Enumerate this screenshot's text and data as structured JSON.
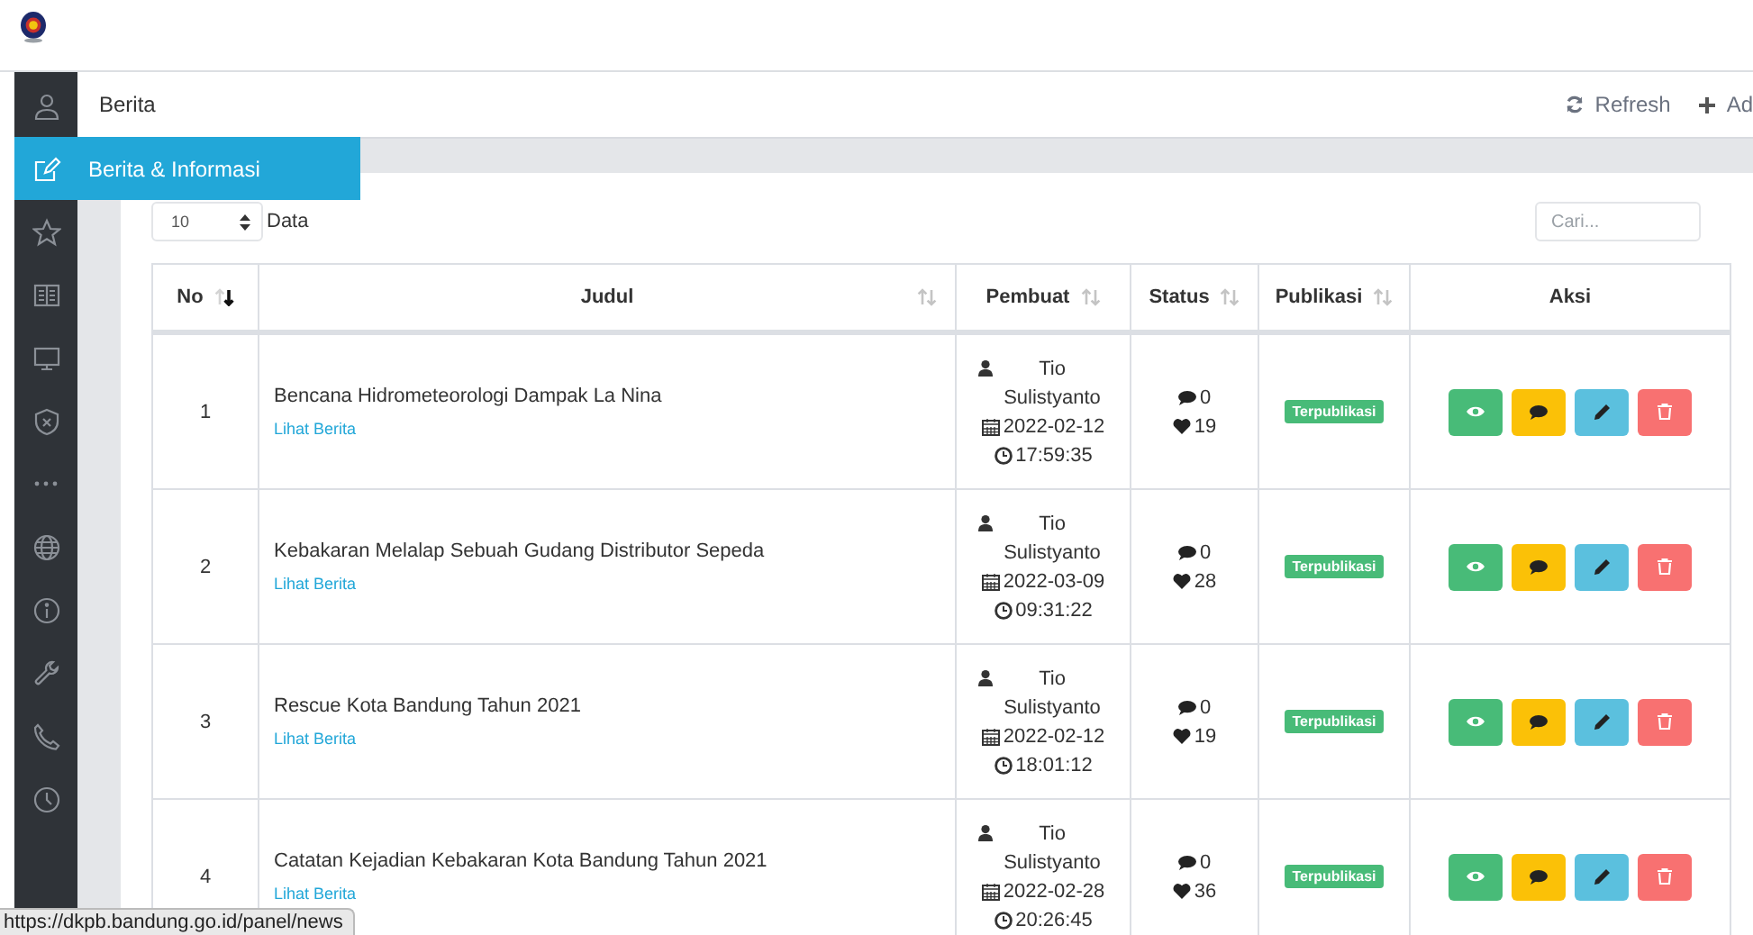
{
  "sidebar": {
    "items": [
      {
        "kind": "user",
        "selected": false
      },
      {
        "kind": "edit",
        "selected": true
      },
      {
        "kind": "star",
        "selected": false
      },
      {
        "kind": "book",
        "selected": false
      },
      {
        "kind": "monitor",
        "selected": false
      },
      {
        "kind": "shield",
        "selected": false
      },
      {
        "kind": "dots",
        "selected": false
      },
      {
        "kind": "globe",
        "selected": false
      },
      {
        "kind": "info",
        "selected": false
      },
      {
        "kind": "wrench",
        "selected": false
      },
      {
        "kind": "phone",
        "selected": false
      },
      {
        "kind": "clock",
        "selected": false
      }
    ],
    "flyout": "Berita & Informasi"
  },
  "toolbar": {
    "title": "Berita",
    "actions": [
      {
        "kind": "refresh",
        "label": "Refresh"
      },
      {
        "kind": "add",
        "label": "Ad"
      }
    ]
  },
  "page_size": {
    "value": "10",
    "label": "Data"
  },
  "search": {
    "placeholder": "Cari..."
  },
  "table": {
    "columns": [
      {
        "label": "No",
        "sortable": true,
        "sorted": true
      },
      {
        "label": "Judul",
        "sortable": true,
        "sorted": false
      },
      {
        "label": "Pembuat",
        "sortable": true,
        "sorted": false
      },
      {
        "label": "Status",
        "sortable": true,
        "sorted": false
      },
      {
        "label": "Publikasi",
        "sortable": true,
        "sorted": false
      },
      {
        "label": "Aksi",
        "sortable": false
      }
    ],
    "actions": [
      {
        "kind": "view"
      },
      {
        "kind": "comment"
      },
      {
        "kind": "edit"
      },
      {
        "kind": "delete"
      }
    ],
    "rows": [
      {
        "no": "1",
        "title": "Bencana Hidrometeorologi Dampak La Nina",
        "link": "Lihat Berita",
        "author": "Tio Sulistyanto",
        "date": "2022-02-12",
        "time": "17:59:35",
        "comments": "0",
        "likes": "19",
        "publication": "Terpublikasi"
      },
      {
        "no": "2",
        "title": "Kebakaran Melalap Sebuah Gudang Distributor Sepeda",
        "link": "Lihat Berita",
        "author": "Tio Sulistyanto",
        "date": "2022-03-09",
        "time": "09:31:22",
        "comments": "0",
        "likes": "28",
        "publication": "Terpublikasi"
      },
      {
        "no": "3",
        "title": "Rescue Kota Bandung Tahun 2021",
        "link": "Lihat Berita",
        "author": "Tio Sulistyanto",
        "date": "2022-02-12",
        "time": "18:01:12",
        "comments": "0",
        "likes": "19",
        "publication": "Terpublikasi"
      },
      {
        "no": "4",
        "title": "Catatan Kejadian Kebakaran Kota Bandung Tahun 2021",
        "link": "Lihat Berita",
        "author": "Tio Sulistyanto",
        "date": "2022-02-28",
        "time": "20:26:45",
        "comments": "0",
        "likes": "36",
        "publication": "Terpublikasi"
      }
    ]
  },
  "status_url": "https://dkpb.bandung.go.id/panel/news"
}
